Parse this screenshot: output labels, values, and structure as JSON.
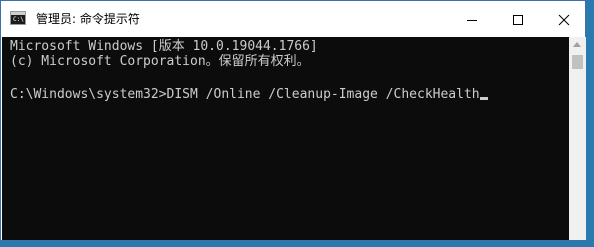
{
  "window": {
    "title": "管理员: 命令提示符",
    "icon": "cmd-prompt-icon",
    "controls": [
      "minimize-icon",
      "maximize-icon",
      "close-icon"
    ]
  },
  "console": {
    "lines": [
      "Microsoft Windows [版本 10.0.19044.1766]",
      "(c) Microsoft Corporation。保留所有权利。",
      "C:\\Windows\\system32>DISM /Online /Cleanup-Image /CheckHealth"
    ],
    "text_color": "#cccccc",
    "background": "#0c0c0c"
  },
  "scrollbar": {
    "up_arrow": "scroll-up-arrow-icon"
  }
}
